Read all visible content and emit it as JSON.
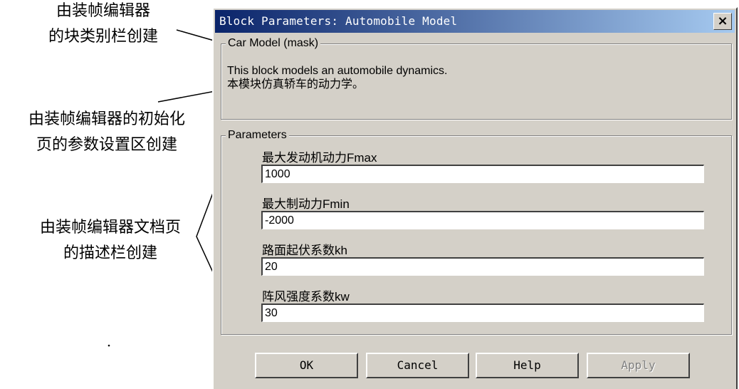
{
  "annotations": {
    "category_note": [
      "由装帧编辑器",
      "的块类别栏创建"
    ],
    "init_note": [
      "由装帧编辑器的初始化",
      "页的参数设置区创建"
    ],
    "doc_note": [
      "由装帧编辑器文档页",
      "的描述栏创建"
    ]
  },
  "dialog": {
    "title": "Block Parameters: Automobile Model",
    "close_icon": "close-icon",
    "mask_group": {
      "title": "Car Model (mask)",
      "description_line1": "This block models an automobile dynamics.",
      "description_line2": "本模块仿真轿车的动力学。"
    },
    "params_group": {
      "title": "Parameters",
      "items": [
        {
          "label": "最大发动机动力Fmax",
          "value": "1000"
        },
        {
          "label": "最大制动力Fmin",
          "value": "-2000"
        },
        {
          "label": "路面起伏系数kh",
          "value": "20"
        },
        {
          "label": "阵风强度系数kw",
          "value": "30"
        }
      ]
    },
    "buttons": {
      "ok": "OK",
      "cancel": "Cancel",
      "help": "Help",
      "apply": "Apply"
    }
  }
}
